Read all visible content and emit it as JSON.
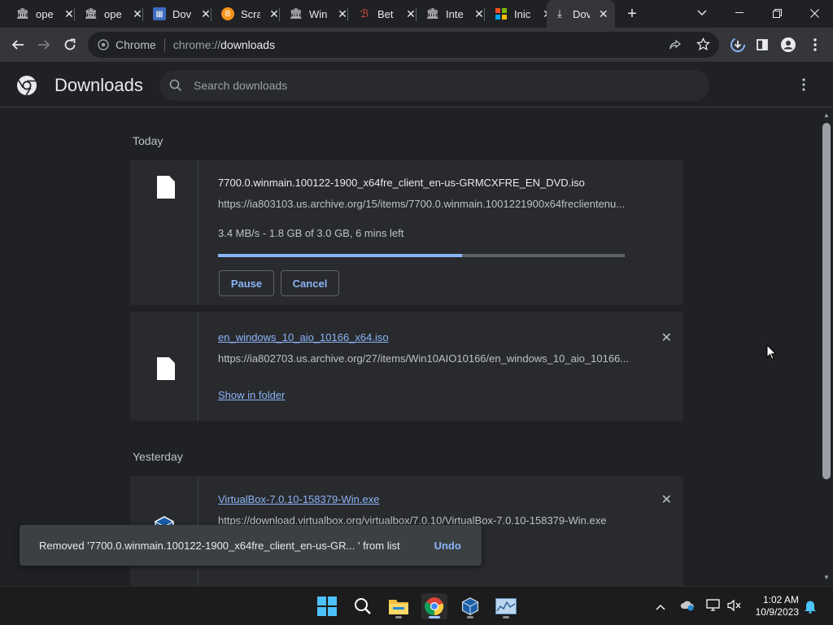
{
  "tabs": [
    {
      "title": "ope",
      "icon": "archive-icon"
    },
    {
      "title": "ope",
      "icon": "archive-icon"
    },
    {
      "title": "Dov",
      "icon": "doc-icon"
    },
    {
      "title": "Scra",
      "icon": "bitcoin-icon"
    },
    {
      "title": "Win",
      "icon": "archive-icon"
    },
    {
      "title": "Bet",
      "icon": "pdf-icon"
    },
    {
      "title": "Inte",
      "icon": "archive-icon"
    },
    {
      "title": "Inic",
      "icon": "microsoft-icon"
    },
    {
      "title": "Dov",
      "icon": "download-icon",
      "active": true
    }
  ],
  "toolbar": {
    "site_label": "Chrome",
    "url_scheme": "chrome://",
    "url_host": "downloads"
  },
  "header": {
    "title": "Downloads",
    "search_placeholder": "Search downloads"
  },
  "groups": [
    {
      "label": "Today",
      "items": [
        {
          "name": "7700.0.winmain.100122-1900_x64fre_client_en-us-GRMCXFRE_EN_DVD.iso",
          "source": "https://ia803103.us.archive.org/15/items/7700.0.winmain.1001221900x64freclientenu...",
          "status": "3.4 MB/s - 1.8 GB of 3.0 GB, 6 mins left",
          "progress": 0.6,
          "pause_label": "Pause",
          "cancel_label": "Cancel"
        },
        {
          "name": "en_windows_10_aio_10166_x64.iso",
          "source": "https://ia802703.us.archive.org/27/items/Win10AIO10166/en_windows_10_aio_10166...",
          "action_label": "Show in folder"
        }
      ]
    },
    {
      "label": "Yesterday",
      "items": [
        {
          "name": "VirtualBox-7.0.10-158379-Win.exe",
          "source": "https://download.virtualbox.org/virtualbox/7.0.10/VirtualBox-7.0.10-158379-Win.exe"
        }
      ]
    }
  ],
  "toast": {
    "message": "Removed '7700.0.winmain.100122-1900_x64fre_client_en-us-GR... ' from list",
    "undo_label": "Undo"
  },
  "taskbar": {
    "time": "1:02 AM",
    "date": "10/9/2023"
  },
  "colors": {
    "accent": "#8ab4f8",
    "background": "#202124",
    "card": "#292a2d"
  }
}
